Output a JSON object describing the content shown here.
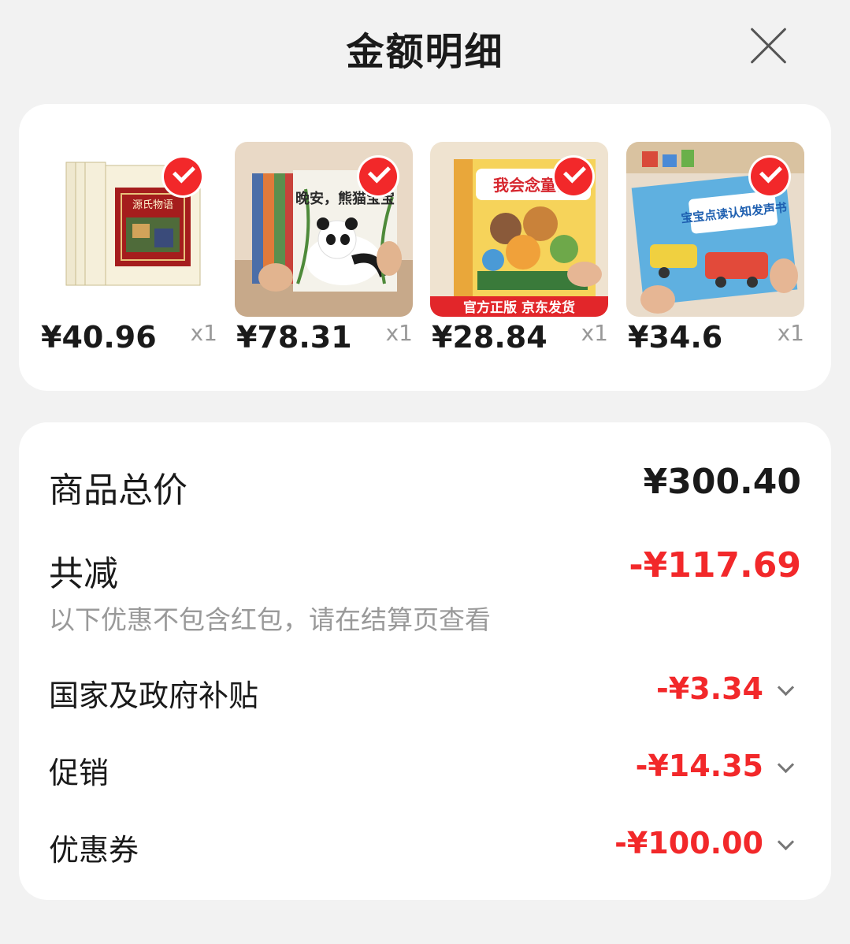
{
  "header": {
    "title": "金额明细"
  },
  "products": [
    {
      "price": "¥40.96",
      "qty": "x1",
      "cover_text": "源氏物语"
    },
    {
      "price": "¥78.31",
      "qty": "x1",
      "cover_text": "晚安，熊猫宝宝"
    },
    {
      "price": "¥28.84",
      "qty": "x1",
      "cover_text": "我会念童谣",
      "banner": "官方正版 京东发货"
    },
    {
      "price": "¥34.6",
      "qty": "x1",
      "cover_text": "宝宝点读认知发声书"
    }
  ],
  "summary": {
    "total_label": "商品总价",
    "total_value": "¥300.40",
    "reduce_label": "共减",
    "reduce_value": "-¥117.69",
    "note": "以下优惠不包含红包，请在结算页查看",
    "items": [
      {
        "label": "国家及政府补贴",
        "value": "-¥3.34"
      },
      {
        "label": "促销",
        "value": "-¥14.35"
      },
      {
        "label": "优惠券",
        "value": "-¥100.00"
      }
    ]
  },
  "colors": {
    "accent": "#f2282a",
    "background": "#f2f2f2",
    "card": "#ffffff"
  }
}
